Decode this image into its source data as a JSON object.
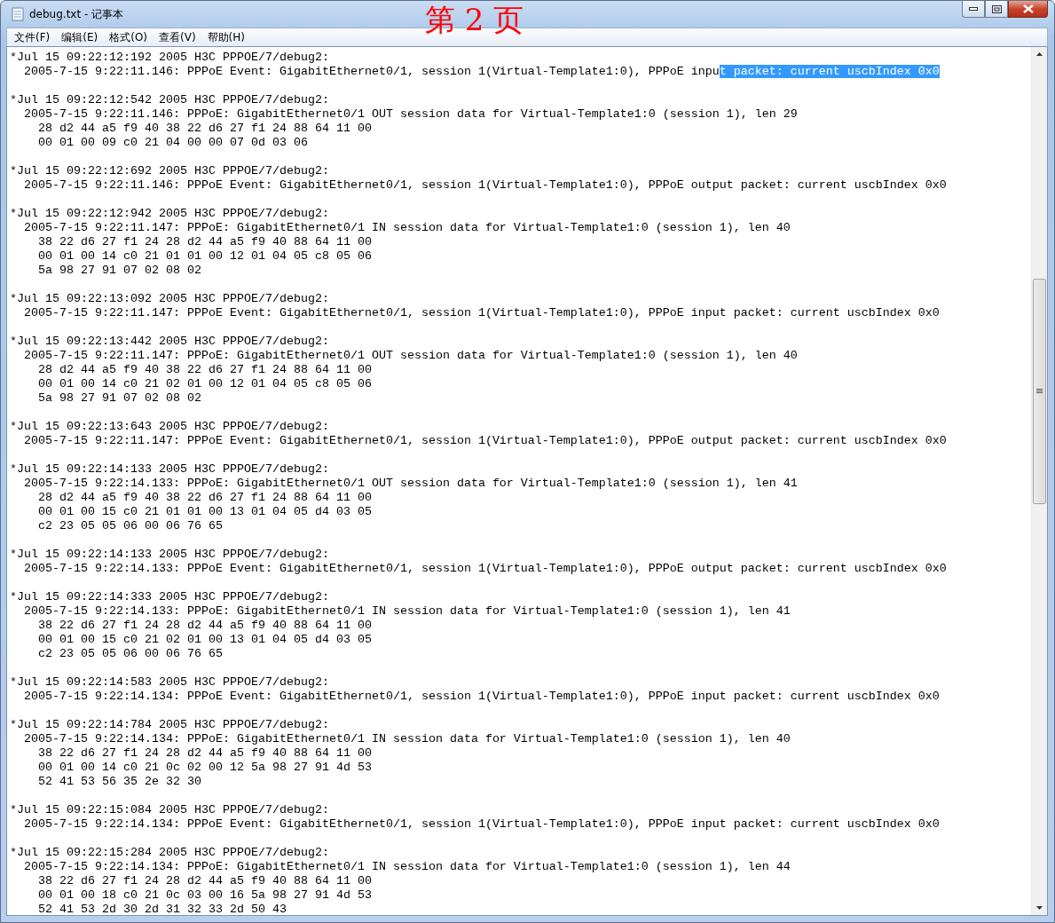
{
  "window": {
    "title": "debug.txt - 记事本",
    "page_stamp": "第 2 页"
  },
  "menu": [
    "文件(F)",
    "编辑(E)",
    "格式(O)",
    "查看(V)",
    "帮助(H)"
  ],
  "entries": [
    {
      "header": "*Jul 15 09:22:12:192 2005 H3C PPPOE/7/debug2:",
      "lines": [
        {
          "text": "  2005-7-15 9:22:11.146: PPPoE Event: GigabitEthernet0/1, session 1(Virtual-Template1:0), PPPoE inpu",
          "selection": "t packet: current uscbIndex 0x0"
        }
      ]
    },
    {
      "header": "*Jul 15 09:22:12:542 2005 H3C PPPOE/7/debug2:",
      "lines": [
        {
          "text": "  2005-7-15 9:22:11.146: PPPoE: GigabitEthernet0/1 OUT session data for Virtual-Template1:0 (session 1), len 29"
        },
        {
          "text": "    28 d2 44 a5 f9 40 38 22 d6 27 f1 24 88 64 11 00"
        },
        {
          "text": "    00 01 00 09 c0 21 04 00 00 07 0d 03 06"
        }
      ]
    },
    {
      "header": "*Jul 15 09:22:12:692 2005 H3C PPPOE/7/debug2:",
      "lines": [
        {
          "text": "  2005-7-15 9:22:11.146: PPPoE Event: GigabitEthernet0/1, session 1(Virtual-Template1:0), PPPoE output packet: current uscbIndex 0x0"
        }
      ]
    },
    {
      "header": "*Jul 15 09:22:12:942 2005 H3C PPPOE/7/debug2:",
      "lines": [
        {
          "text": "  2005-7-15 9:22:11.147: PPPoE: GigabitEthernet0/1 IN session data for Virtual-Template1:0 (session 1), len 40"
        },
        {
          "text": "    38 22 d6 27 f1 24 28 d2 44 a5 f9 40 88 64 11 00"
        },
        {
          "text": "    00 01 00 14 c0 21 01 01 00 12 01 04 05 c8 05 06"
        },
        {
          "text": "    5a 98 27 91 07 02 08 02"
        }
      ]
    },
    {
      "header": "*Jul 15 09:22:13:092 2005 H3C PPPOE/7/debug2:",
      "lines": [
        {
          "text": "  2005-7-15 9:22:11.147: PPPoE Event: GigabitEthernet0/1, session 1(Virtual-Template1:0), PPPoE input packet: current uscbIndex 0x0"
        }
      ]
    },
    {
      "header": "*Jul 15 09:22:13:442 2005 H3C PPPOE/7/debug2:",
      "lines": [
        {
          "text": "  2005-7-15 9:22:11.147: PPPoE: GigabitEthernet0/1 OUT session data for Virtual-Template1:0 (session 1), len 40"
        },
        {
          "text": "    28 d2 44 a5 f9 40 38 22 d6 27 f1 24 88 64 11 00"
        },
        {
          "text": "    00 01 00 14 c0 21 02 01 00 12 01 04 05 c8 05 06"
        },
        {
          "text": "    5a 98 27 91 07 02 08 02"
        }
      ]
    },
    {
      "header": "*Jul 15 09:22:13:643 2005 H3C PPPOE/7/debug2:",
      "lines": [
        {
          "text": "  2005-7-15 9:22:11.147: PPPoE Event: GigabitEthernet0/1, session 1(Virtual-Template1:0), PPPoE output packet: current uscbIndex 0x0"
        }
      ]
    },
    {
      "header": "*Jul 15 09:22:14:133 2005 H3C PPPOE/7/debug2:",
      "lines": [
        {
          "text": "  2005-7-15 9:22:14.133: PPPoE: GigabitEthernet0/1 OUT session data for Virtual-Template1:0 (session 1), len 41"
        },
        {
          "text": "    28 d2 44 a5 f9 40 38 22 d6 27 f1 24 88 64 11 00"
        },
        {
          "text": "    00 01 00 15 c0 21 01 01 00 13 01 04 05 d4 03 05"
        },
        {
          "text": "    c2 23 05 05 06 00 06 76 65"
        }
      ]
    },
    {
      "header": "*Jul 15 09:22:14:133 2005 H3C PPPOE/7/debug2:",
      "lines": [
        {
          "text": "  2005-7-15 9:22:14.133: PPPoE Event: GigabitEthernet0/1, session 1(Virtual-Template1:0), PPPoE output packet: current uscbIndex 0x0"
        }
      ]
    },
    {
      "header": "*Jul 15 09:22:14:333 2005 H3C PPPOE/7/debug2:",
      "lines": [
        {
          "text": "  2005-7-15 9:22:14.133: PPPoE: GigabitEthernet0/1 IN session data for Virtual-Template1:0 (session 1), len 41"
        },
        {
          "text": "    38 22 d6 27 f1 24 28 d2 44 a5 f9 40 88 64 11 00"
        },
        {
          "text": "    00 01 00 15 c0 21 02 01 00 13 01 04 05 d4 03 05"
        },
        {
          "text": "    c2 23 05 05 06 00 06 76 65"
        }
      ]
    },
    {
      "header": "*Jul 15 09:22:14:583 2005 H3C PPPOE/7/debug2:",
      "lines": [
        {
          "text": "  2005-7-15 9:22:14.134: PPPoE Event: GigabitEthernet0/1, session 1(Virtual-Template1:0), PPPoE input packet: current uscbIndex 0x0"
        }
      ]
    },
    {
      "header": "*Jul 15 09:22:14:784 2005 H3C PPPOE/7/debug2:",
      "lines": [
        {
          "text": "  2005-7-15 9:22:14.134: PPPoE: GigabitEthernet0/1 IN session data for Virtual-Template1:0 (session 1), len 40"
        },
        {
          "text": "    38 22 d6 27 f1 24 28 d2 44 a5 f9 40 88 64 11 00"
        },
        {
          "text": "    00 01 00 14 c0 21 0c 02 00 12 5a 98 27 91 4d 53"
        },
        {
          "text": "    52 41 53 56 35 2e 32 30"
        }
      ]
    },
    {
      "header": "*Jul 15 09:22:15:084 2005 H3C PPPOE/7/debug2:",
      "lines": [
        {
          "text": "  2005-7-15 9:22:14.134: PPPoE Event: GigabitEthernet0/1, session 1(Virtual-Template1:0), PPPoE input packet: current uscbIndex 0x0"
        }
      ]
    },
    {
      "header": "*Jul 15 09:22:15:284 2005 H3C PPPOE/7/debug2:",
      "lines": [
        {
          "text": "  2005-7-15 9:22:14.134: PPPoE: GigabitEthernet0/1 IN session data for Virtual-Template1:0 (session 1), len 44"
        },
        {
          "text": "    38 22 d6 27 f1 24 28 d2 44 a5 f9 40 88 64 11 00"
        },
        {
          "text": "    00 01 00 18 c0 21 0c 03 00 16 5a 98 27 91 4d 53"
        },
        {
          "text": "    52 41 53 2d 30 2d 31 32 33 2d 50 43"
        }
      ]
    }
  ]
}
